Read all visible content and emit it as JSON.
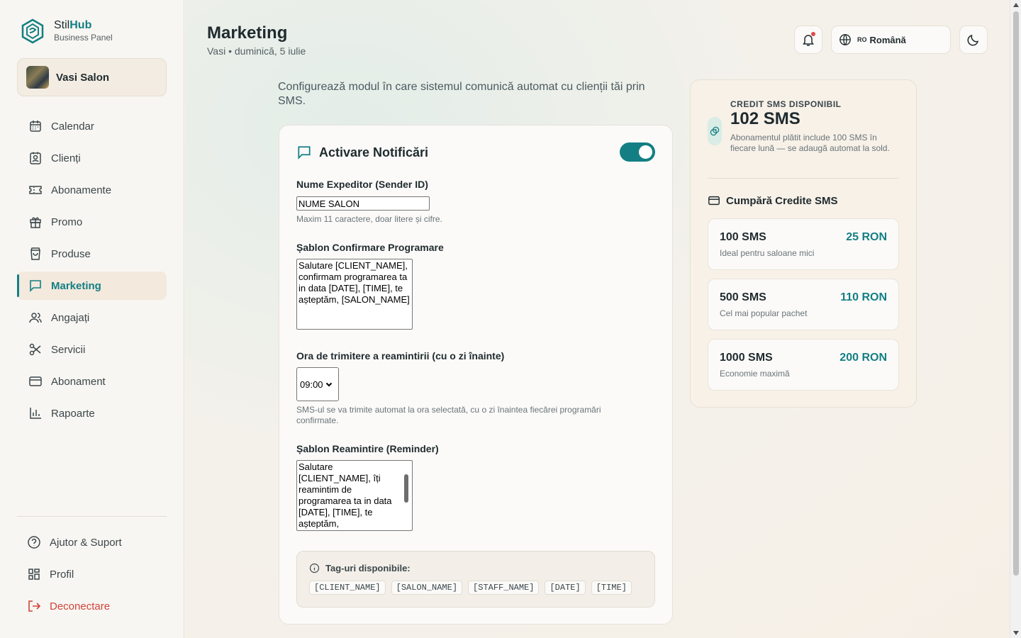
{
  "brand": {
    "name_prefix": "Stil",
    "name_suffix": "Hub",
    "subtitle": "Business Panel"
  },
  "salon": {
    "name": "Vasi Salon"
  },
  "sidebar": {
    "items": [
      {
        "label": "Calendar",
        "icon": "calendar-icon"
      },
      {
        "label": "Clienți",
        "icon": "contact-icon"
      },
      {
        "label": "Abonamente",
        "icon": "ticket-icon"
      },
      {
        "label": "Promo",
        "icon": "gift-icon"
      },
      {
        "label": "Produse",
        "icon": "bag-icon"
      },
      {
        "label": "Marketing",
        "icon": "message-icon",
        "active": true
      },
      {
        "label": "Angajați",
        "icon": "users-icon"
      },
      {
        "label": "Servicii",
        "icon": "scissors-icon"
      },
      {
        "label": "Abonament",
        "icon": "card-icon"
      },
      {
        "label": "Rapoarte",
        "icon": "bar-chart-icon"
      }
    ],
    "bottom": [
      {
        "label": "Ajutor & Suport",
        "icon": "help-icon"
      },
      {
        "label": "Profil",
        "icon": "grid-icon"
      },
      {
        "label": "Deconectare",
        "icon": "logout-icon"
      }
    ]
  },
  "header": {
    "title": "Marketing",
    "subtitle": "Vasi • duminică, 5 iulie",
    "language_code": "RO",
    "language": "Română"
  },
  "intro": "Configurează modul în care sistemul comunică automat cu clienții tăi prin SMS.",
  "form": {
    "title": "Activare Notificări",
    "toggle_on": true,
    "sender_label": "Nume Expeditor (Sender ID)",
    "sender_value": "NUME SALON",
    "sender_hint": "Maxim 11 caractere, doar litere și cifre.",
    "confirm_label": "Șablon Confirmare Programare",
    "confirm_text": "Salutare [CLIENT_NAME], confirmam programarea ta in data [DATE], [TIME], te așteptăm, [SALON_NAME]",
    "reminder_time_label": "Ora de trimitere a reamintirii (cu o zi înainte)",
    "reminder_time_value": "09:00",
    "reminder_time_hint": "SMS-ul se va trimite automat la ora selectată, cu o zi înaintea fiecărei programări confirmate.",
    "reminder_label": "Șablon Reamintire (Reminder)",
    "reminder_text": "Salutare [CLIENT_NAME], îți reamintim de programarea ta in data [DATE], [TIME], te așteptăm,",
    "tags_title": "Tag-uri disponibile:",
    "tags": [
      "[CLIENT_NAME]",
      "[SALON_NAME]",
      "[STAFF_NAME]",
      "[DATE]",
      "[TIME]"
    ]
  },
  "credit": {
    "label": "CREDIT SMS DISPONIBIL",
    "value": "102 SMS",
    "note": "Abonamentul plătit include 100 SMS în fiecare lună — se adaugă automat la sold.",
    "buy_title": "Cumpără Credite SMS",
    "packages": [
      {
        "name": "100 SMS",
        "desc": "Ideal pentru saloane mici",
        "price": "25 RON"
      },
      {
        "name": "500 SMS",
        "desc": "Cel mai popular pachet",
        "price": "110 RON"
      },
      {
        "name": "1000 SMS",
        "desc": "Economie maximă",
        "price": "200 RON"
      }
    ]
  },
  "colors": {
    "accent": "#137f84",
    "danger": "#d0433a",
    "notification_dot": "#e04b4b"
  }
}
